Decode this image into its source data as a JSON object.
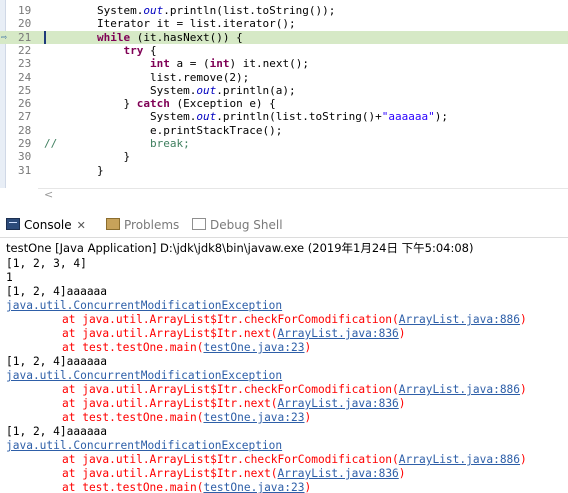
{
  "editor": {
    "lines": [
      {
        "num": "19",
        "parts": [
          {
            "t": "        System."
          },
          {
            "t": "out",
            "c": "fld"
          },
          {
            "t": ".println(list.toString());"
          }
        ]
      },
      {
        "num": "20",
        "parts": [
          {
            "t": "        Iterator it = list.iterator();"
          }
        ]
      },
      {
        "num": "21",
        "current": true,
        "parts": [
          {
            "t": "        "
          },
          {
            "t": "while",
            "c": "kw"
          },
          {
            "t": " (it.hasNext()) {"
          }
        ]
      },
      {
        "num": "22",
        "parts": [
          {
            "t": "            "
          },
          {
            "t": "try",
            "c": "kw"
          },
          {
            "t": " {"
          }
        ]
      },
      {
        "num": "23",
        "parts": [
          {
            "t": "                "
          },
          {
            "t": "int",
            "c": "kw"
          },
          {
            "t": " a = ("
          },
          {
            "t": "int",
            "c": "kw"
          },
          {
            "t": ") it.next();"
          }
        ]
      },
      {
        "num": "24",
        "parts": [
          {
            "t": "                list.remove(2);"
          }
        ]
      },
      {
        "num": "25",
        "parts": [
          {
            "t": "                System."
          },
          {
            "t": "out",
            "c": "fld"
          },
          {
            "t": ".println(a);"
          }
        ]
      },
      {
        "num": "26",
        "parts": [
          {
            "t": "            } "
          },
          {
            "t": "catch",
            "c": "kw"
          },
          {
            "t": " (Exception e) {"
          }
        ]
      },
      {
        "num": "27",
        "parts": [
          {
            "t": "                System."
          },
          {
            "t": "out",
            "c": "fld"
          },
          {
            "t": ".println(list.toString()+"
          },
          {
            "t": "\"aaaaaa\"",
            "c": "str"
          },
          {
            "t": ");"
          }
        ]
      },
      {
        "num": "28",
        "parts": [
          {
            "t": "                e.printStackTrace();"
          }
        ]
      },
      {
        "num": "29",
        "parts": [
          {
            "t": "//              break;",
            "c": "cmt"
          }
        ]
      },
      {
        "num": "30",
        "parts": [
          {
            "t": "            }"
          }
        ]
      },
      {
        "num": "31",
        "parts": [
          {
            "t": "        }"
          }
        ]
      }
    ],
    "debug_arrow": "⇨",
    "scroll_left": "<"
  },
  "tabs": [
    {
      "label": "Console",
      "close": "✕"
    },
    {
      "label": "Problems"
    },
    {
      "label": "Debug Shell"
    }
  ],
  "launch_description": "testOne [Java Application] D:\\jdk\\jdk8\\bin\\javaw.exe (2019年1月24日 下午5:04:08)",
  "console": [
    {
      "type": "stdout",
      "text": "[1, 2, 3, 4]"
    },
    {
      "type": "stdout",
      "text": "1"
    },
    {
      "type": "stdout",
      "text": "[1, 2, 4]aaaaaa"
    },
    {
      "type": "exc",
      "text": "java.util.ConcurrentModificationException"
    },
    {
      "type": "frame",
      "pre": "at java.util.ArrayList$Itr.checkForComodification(",
      "link": "ArrayList.java:886",
      "post": ")"
    },
    {
      "type": "frame",
      "pre": "at java.util.ArrayList$Itr.next(",
      "link": "ArrayList.java:836",
      "post": ")"
    },
    {
      "type": "frame",
      "pre": "at test.testOne.main(",
      "link": "testOne.java:23",
      "post": ")"
    },
    {
      "type": "stdout",
      "text": "[1, 2, 4]aaaaaa"
    },
    {
      "type": "exc",
      "text": "java.util.ConcurrentModificationException"
    },
    {
      "type": "frame",
      "pre": "at java.util.ArrayList$Itr.checkForComodification(",
      "link": "ArrayList.java:886",
      "post": ")"
    },
    {
      "type": "frame",
      "pre": "at java.util.ArrayList$Itr.next(",
      "link": "ArrayList.java:836",
      "post": ")"
    },
    {
      "type": "frame",
      "pre": "at test.testOne.main(",
      "link": "testOne.java:23",
      "post": ")"
    },
    {
      "type": "stdout",
      "text": "[1, 2, 4]aaaaaa"
    },
    {
      "type": "exc",
      "text": "java.util.ConcurrentModificationException"
    },
    {
      "type": "frame",
      "pre": "at java.util.ArrayList$Itr.checkForComodification(",
      "link": "ArrayList.java:886",
      "post": ")"
    },
    {
      "type": "frame",
      "pre": "at java.util.ArrayList$Itr.next(",
      "link": "ArrayList.java:836",
      "post": ")"
    },
    {
      "type": "frame",
      "pre": "at test.testOne.main(",
      "link": "testOne.java:23",
      "post": ")"
    }
  ],
  "colors": {
    "keyword": "#7f0055",
    "static_field": "#0000c0",
    "string": "#2a00ff",
    "comment": "#3f7f5f",
    "current_line": "#d6e9c6",
    "stderr": "#ff0000",
    "link": "#2e5fa8"
  }
}
